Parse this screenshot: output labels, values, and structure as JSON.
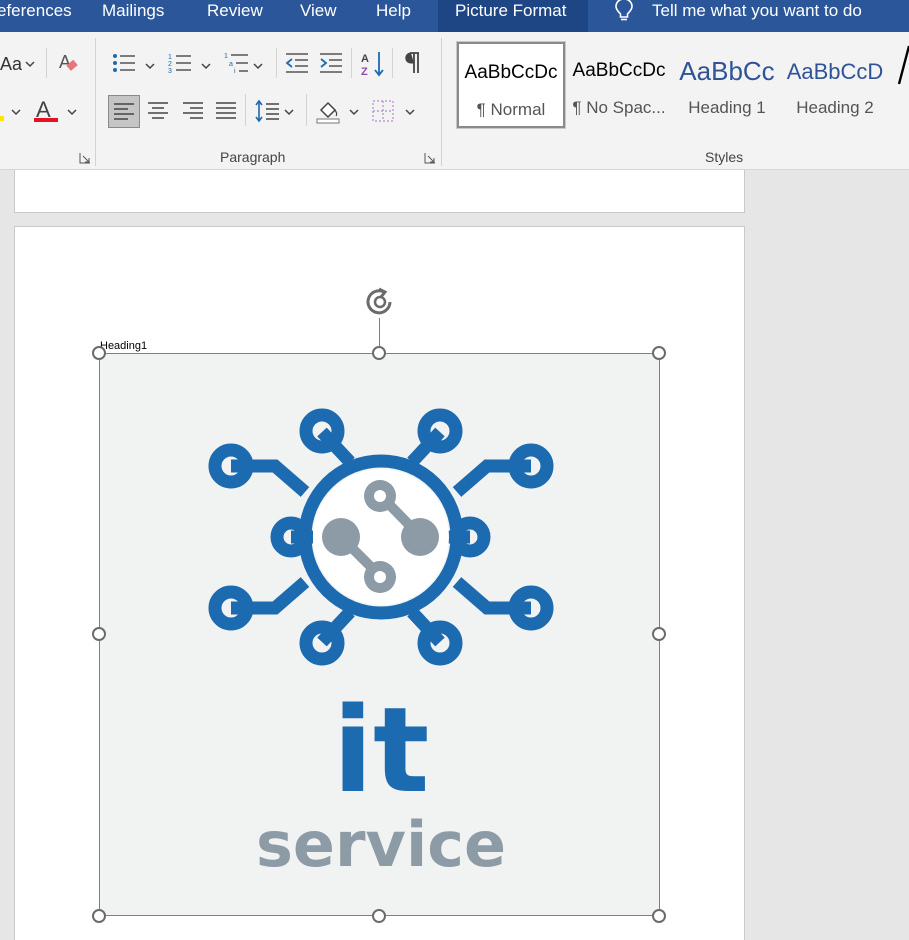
{
  "tabs": [
    {
      "label": "eferences",
      "active": false
    },
    {
      "label": "Mailings",
      "active": false
    },
    {
      "label": "Review",
      "active": false
    },
    {
      "label": "View",
      "active": false
    },
    {
      "label": "Help",
      "active": false
    },
    {
      "label": "Picture Format",
      "active": true
    }
  ],
  "tell_me": "Tell me what you want to do",
  "ribbon": {
    "font_case_label": "Aa",
    "paragraph_group_label": "Paragraph",
    "styles_group_label": "Styles",
    "styles": [
      {
        "sample": "AaBbCcDc",
        "name": "¶ Normal",
        "selected": true
      },
      {
        "sample": "AaBbCcDc",
        "name": "¶ No Spac...",
        "selected": false
      },
      {
        "sample": "AaBbCc",
        "name": "Heading 1",
        "selected": false
      },
      {
        "sample": "AaBbCcD",
        "name": "Heading 2",
        "selected": false
      }
    ]
  },
  "document": {
    "anchor_label": "Heading1",
    "logo": {
      "main_text": "it",
      "sub_text": "service"
    }
  },
  "colors": {
    "accent": "#2b579a",
    "logo_blue": "#1c6aaf",
    "logo_gray": "#8d9ba6"
  }
}
